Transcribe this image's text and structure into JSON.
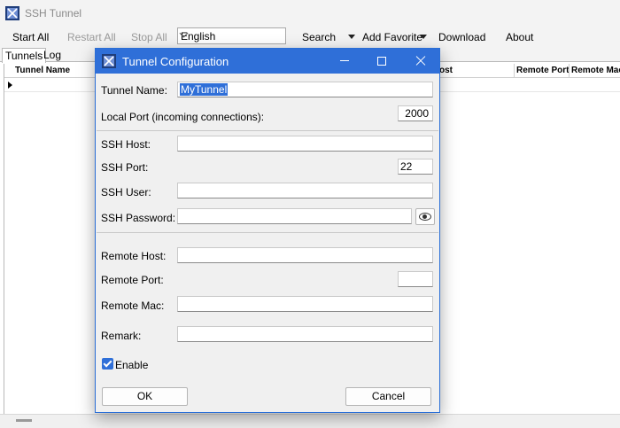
{
  "app": {
    "title": "SSH Tunnel"
  },
  "toolbar": {
    "start_all": "Start All",
    "restart_all": "Restart All",
    "stop_all": "Stop All",
    "language": "English",
    "search": "Search",
    "add_favorite": "Add Favorite",
    "download": "Download",
    "about": "About"
  },
  "tabs": [
    {
      "label": "Tunnels",
      "active": true
    },
    {
      "label": "Log",
      "active": false
    }
  ],
  "grid": {
    "columns": [
      "Tunnel Name",
      "ost",
      "Remote Port",
      "Remote Mac"
    ]
  },
  "dialog": {
    "title": "Tunnel Configuration",
    "fields": {
      "tunnel_name": {
        "label": "Tunnel Name:",
        "value": "MyTunnel"
      },
      "local_port": {
        "label": "Local Port (incoming connections):",
        "value": "2000"
      },
      "ssh_host": {
        "label": "SSH Host:",
        "value": ""
      },
      "ssh_port": {
        "label": "SSH Port:",
        "value": "22"
      },
      "ssh_user": {
        "label": "SSH User:",
        "value": ""
      },
      "ssh_password": {
        "label": "SSH Password:",
        "value": ""
      },
      "remote_host": {
        "label": "Remote Host:",
        "value": ""
      },
      "remote_port": {
        "label": "Remote Port:",
        "value": ""
      },
      "remote_mac": {
        "label": "Remote Mac:",
        "value": ""
      },
      "remark": {
        "label": "Remark:",
        "value": ""
      }
    },
    "enable": {
      "label": "Enable",
      "checked": true
    },
    "ok_label": "OK",
    "cancel_label": "Cancel"
  },
  "colors": {
    "accent": "#2f6fd8",
    "window_bg": "#f0f0f0"
  }
}
